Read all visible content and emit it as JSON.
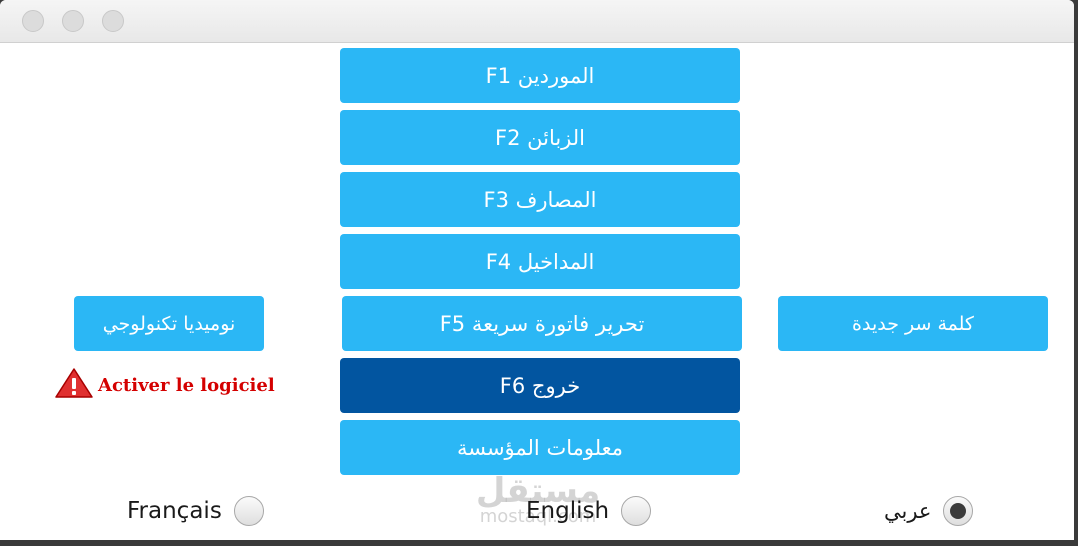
{
  "window": {
    "controls": [
      "close",
      "minimize",
      "zoom"
    ]
  },
  "menu": {
    "suppliers": "F1 الموردين",
    "customers": "F2 الزبائن",
    "expenses": "F3 المصارف",
    "income": "F4 المداخيل",
    "quick_invoice": "F5 تحرير فاتورة سريعة",
    "exit": "F6 خروج",
    "company_info": "معلومات المؤسسة"
  },
  "side": {
    "vendor": "نوميديا تكنولوجي",
    "new_password": "كلمة سر جديدة"
  },
  "activation": {
    "text": "Activer le logiciel",
    "icon": "warning-icon"
  },
  "languages": {
    "french": "Français",
    "english": "English",
    "arabic": "عربي",
    "selected": "arabic"
  },
  "watermark": {
    "logo": "مستقل",
    "site": "mostaql.com"
  },
  "colors": {
    "button": "#2bb7f5",
    "button_active": "#0255a0",
    "warning": "#d40000"
  }
}
